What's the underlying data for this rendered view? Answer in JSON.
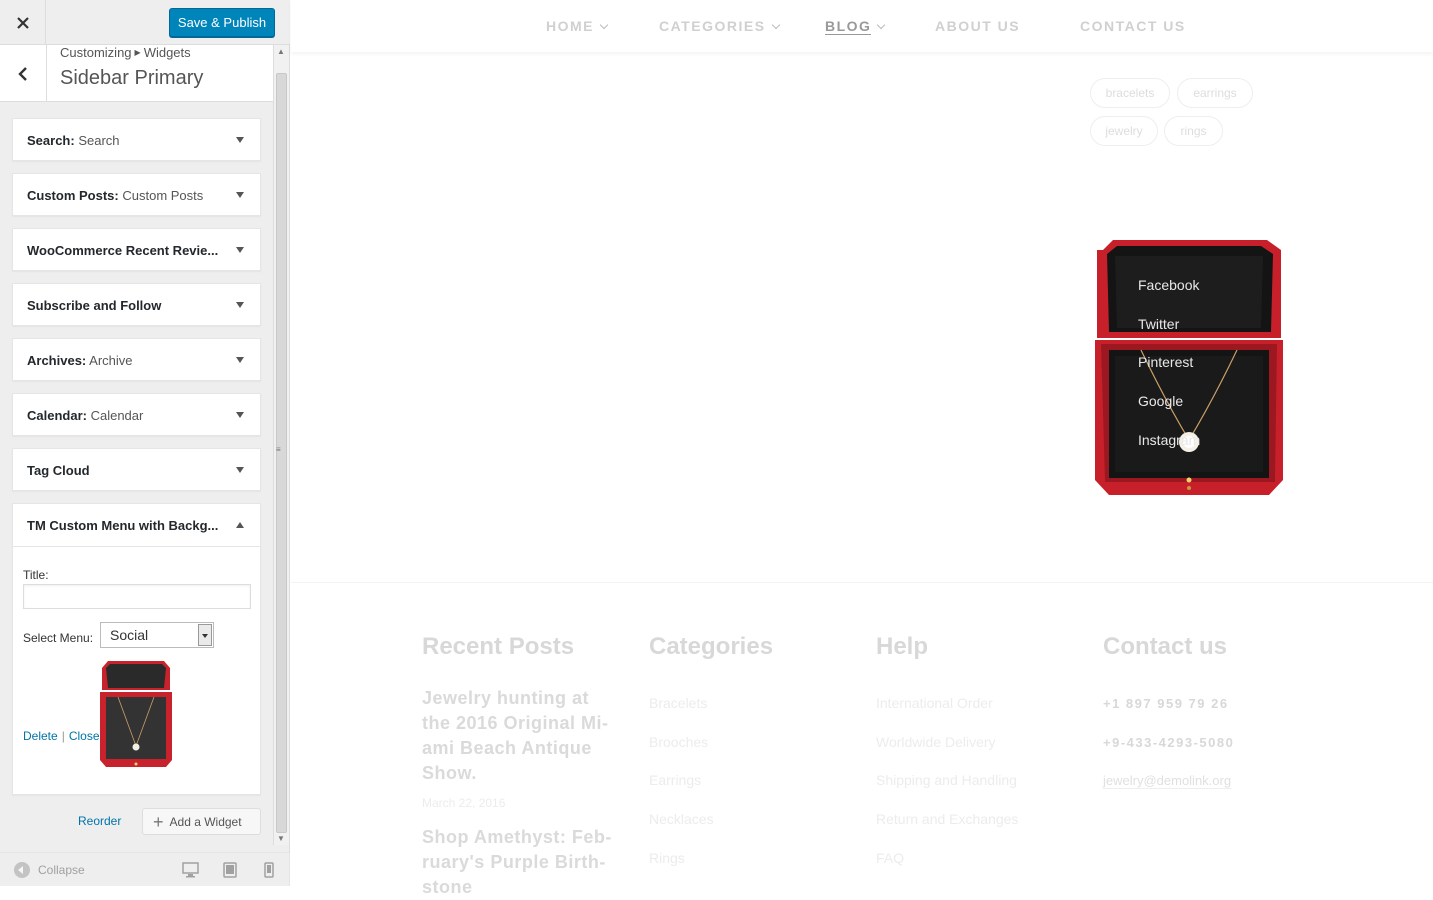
{
  "customizer": {
    "close_icon": "close-icon",
    "save_label": "Save & Publish",
    "breadcrumb": [
      "Customizing",
      "Widgets"
    ],
    "section_title": "Sidebar Primary",
    "widgets": [
      {
        "title": "Search:",
        "subtitle": "Search"
      },
      {
        "title": "Custom Posts:",
        "subtitle": "Custom Posts"
      },
      {
        "title": "WooCommerce Recent Revie...",
        "subtitle": ""
      },
      {
        "title": "Subscribe and Follow",
        "subtitle": ""
      },
      {
        "title": "Archives:",
        "subtitle": "Archive"
      },
      {
        "title": "Calendar:",
        "subtitle": "Calendar"
      },
      {
        "title": "Tag Cloud",
        "subtitle": ""
      }
    ],
    "open_widget": {
      "title": "TM Custom Menu with Backg...",
      "title_label": "Title:",
      "title_value": "",
      "menu_label": "Select Menu:",
      "menu_value": "Social",
      "delete_label": "Delete",
      "close_label": "Close"
    },
    "reorder_label": "Reorder",
    "add_widget_label": "Add a Widget",
    "collapse_label": "Collapse",
    "colors": {
      "primary": "#0085ba",
      "link": "#0073aa"
    }
  },
  "preview": {
    "nav": [
      {
        "label": "HOME",
        "dropdown": true
      },
      {
        "label": "CATEGORIES",
        "dropdown": true
      },
      {
        "label": "BLOG",
        "dropdown": true,
        "active": true
      },
      {
        "label": "ABOUT US",
        "dropdown": false
      },
      {
        "label": "CONTACT US",
        "dropdown": false
      }
    ],
    "tags": [
      "bracelets",
      "earrings",
      "jewelry",
      "rings"
    ],
    "social_menu": [
      "Facebook",
      "Twitter",
      "Pinterest",
      "Google",
      "Instagram"
    ],
    "footer": {
      "recent_posts": {
        "heading": "Recent Posts",
        "post1": "Jewelry hunting at the 2016 Original Mi-ami Beach Antique Show.",
        "post1_date": "March 22, 2016",
        "post2": "Shop Amethyst: Feb-ruary's Purple Birth-stone"
      },
      "categories": {
        "heading": "Categories",
        "items": [
          "Bracelets",
          "Brooches",
          "Earrings",
          "Necklaces",
          "Rings"
        ]
      },
      "help": {
        "heading": "Help",
        "items": [
          "International Order",
          "Worldwide Delivery",
          "Shipping and Handling",
          "Return and Exchanges",
          "FAQ"
        ]
      },
      "contact": {
        "heading": "Contact us",
        "phone1": "+1 897 959 79 26",
        "phone2": "+9-433-4293-5080",
        "email": "jewelry@demolink.org"
      }
    }
  }
}
